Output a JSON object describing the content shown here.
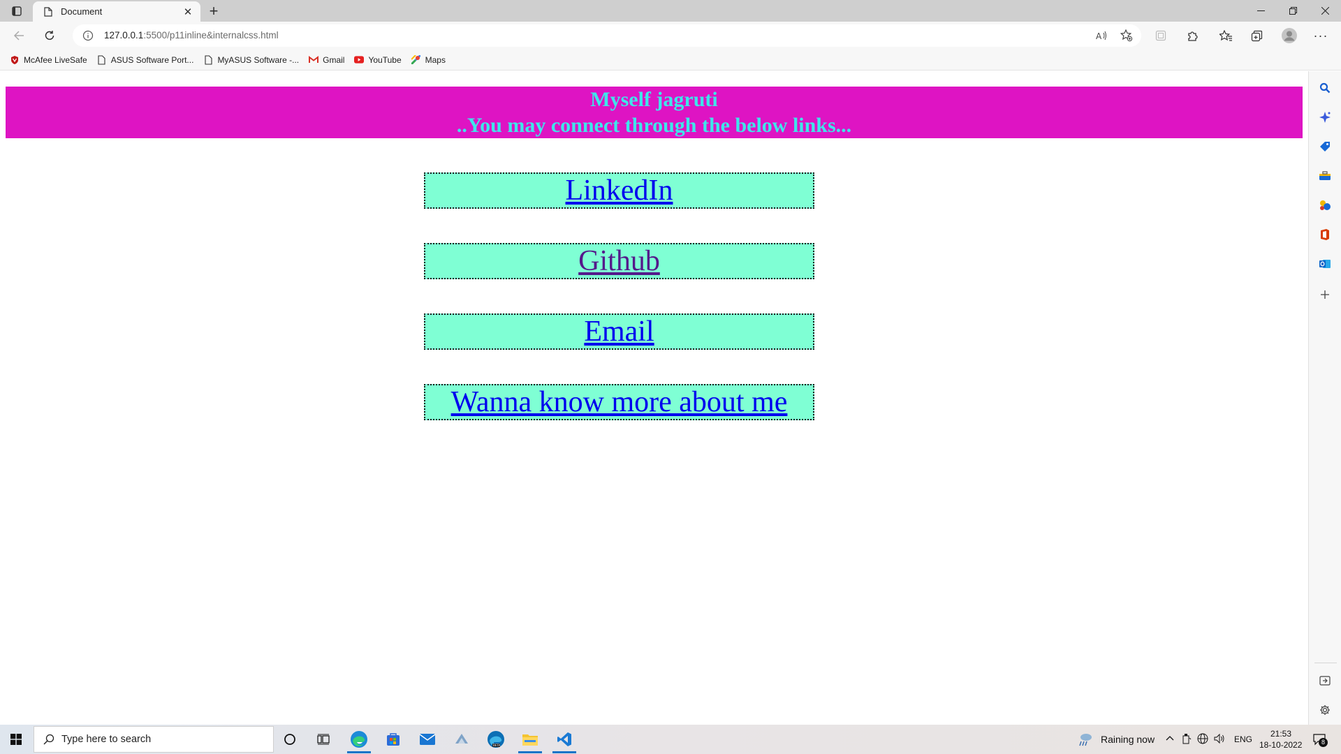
{
  "browser": {
    "tab_title": "Document",
    "url_host": "127.0.0.1",
    "url_rest": ":5500/p11inline&internalcss.html"
  },
  "bookmarks": [
    {
      "label": "McAfee LiveSafe",
      "icon": "mcafee-icon"
    },
    {
      "label": "ASUS Software Port...",
      "icon": "page-icon"
    },
    {
      "label": "MyASUS Software -...",
      "icon": "page-icon"
    },
    {
      "label": "Gmail",
      "icon": "gmail-icon"
    },
    {
      "label": "YouTube",
      "icon": "youtube-icon"
    },
    {
      "label": "Maps",
      "icon": "maps-icon"
    }
  ],
  "page": {
    "banner_line1": "Myself jagruti",
    "banner_line2": "..You may connect through the below links...",
    "links": [
      {
        "label": "LinkedIn",
        "visited": false
      },
      {
        "label": "Github",
        "visited": true
      },
      {
        "label": "Email",
        "visited": false
      },
      {
        "label": "Wanna know more about me",
        "visited": false
      }
    ],
    "colors": {
      "banner_bg": "#de14c3",
      "banner_text": "#3fe6ea",
      "link_box_bg": "#7fffd4",
      "link": "#0000ee",
      "visited_link": "#551a8b"
    }
  },
  "taskbar": {
    "search_placeholder": "Type here to search",
    "weather": "Raining now",
    "language": "ENG",
    "time": "21:53",
    "date": "18-10-2022",
    "notification_count": "8"
  }
}
